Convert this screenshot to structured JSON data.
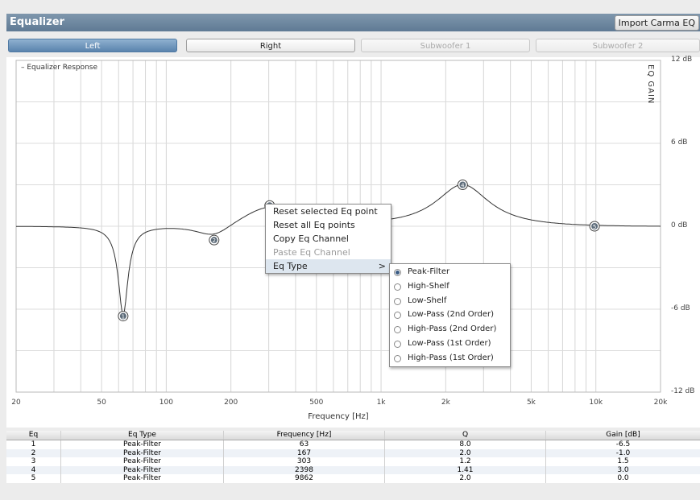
{
  "window": {
    "title": "Equalizer",
    "import_button": "Import Carma EQ"
  },
  "tabs": [
    {
      "label": "Left",
      "state": "active"
    },
    {
      "label": "Right",
      "state": "normal"
    },
    {
      "label": "Subwoofer 1",
      "state": "disabled"
    },
    {
      "label": "Subwoofer 2",
      "state": "disabled"
    }
  ],
  "chart_data": {
    "type": "line",
    "legend_label": "– Equalizer Response",
    "y_axis_label": "EQ GAIN",
    "xlabel": "Frequency [Hz]",
    "x_scale": "log",
    "xlim": [
      20,
      20000
    ],
    "ylim": [
      -12,
      12
    ],
    "x_ticks": [
      {
        "value": 20,
        "label": "20"
      },
      {
        "value": 50,
        "label": "50"
      },
      {
        "value": 100,
        "label": "100"
      },
      {
        "value": 200,
        "label": "200"
      },
      {
        "value": 500,
        "label": "500"
      },
      {
        "value": 1000,
        "label": "1k"
      },
      {
        "value": 2000,
        "label": "2k"
      },
      {
        "value": 5000,
        "label": "5k"
      },
      {
        "value": 10000,
        "label": "10k"
      },
      {
        "value": 20000,
        "label": "20k"
      }
    ],
    "y_ticks": [
      {
        "value": 12,
        "label": "12 dB"
      },
      {
        "value": 6,
        "label": "6 dB"
      },
      {
        "value": 0,
        "label": "0 dB"
      },
      {
        "value": -6,
        "label": "-6 dB"
      },
      {
        "value": -12,
        "label": "-12 dB"
      }
    ],
    "eq_points": [
      {
        "id": "1",
        "freq": 63,
        "gain": -6.5,
        "q": 8.0
      },
      {
        "id": "2",
        "freq": 167,
        "gain": -1.0,
        "q": 2.0
      },
      {
        "id": "3",
        "freq": 303,
        "gain": 1.5,
        "q": 1.2
      },
      {
        "id": "4",
        "freq": 2398,
        "gain": 3.0,
        "q": 1.41
      },
      {
        "id": "5",
        "freq": 9862,
        "gain": 0.0,
        "q": 2.0
      }
    ],
    "grid": true
  },
  "context_menu": {
    "items": [
      {
        "label": "Reset selected Eq point",
        "enabled": true
      },
      {
        "label": "Reset all Eq points",
        "enabled": true
      },
      {
        "label": "Copy Eq Channel",
        "enabled": true
      },
      {
        "label": "Paste Eq Channel",
        "enabled": false
      },
      {
        "label": "Eq Type",
        "enabled": true,
        "submenu": true,
        "arrow": ">"
      }
    ],
    "submenu": [
      {
        "label": "Peak-Filter",
        "selected": true
      },
      {
        "label": "High-Shelf",
        "selected": false
      },
      {
        "label": "Low-Shelf",
        "selected": false
      },
      {
        "label": "Low-Pass (2nd Order)",
        "selected": false
      },
      {
        "label": "High-Pass (2nd Order)",
        "selected": false
      },
      {
        "label": "Low-Pass (1st Order)",
        "selected": false
      },
      {
        "label": "High-Pass (1st Order)",
        "selected": false
      }
    ]
  },
  "table": {
    "columns": [
      "Eq",
      "Eq Type",
      "Frequency [Hz]",
      "Q",
      "Gain [dB]"
    ],
    "rows": [
      [
        "1",
        "Peak-Filter",
        "63",
        "8.0",
        "-6.5"
      ],
      [
        "2",
        "Peak-Filter",
        "167",
        "2.0",
        "-1.0"
      ],
      [
        "3",
        "Peak-Filter",
        "303",
        "1.2",
        "1.5"
      ],
      [
        "4",
        "Peak-Filter",
        "2398",
        "1.41",
        "3.0"
      ],
      [
        "5",
        "Peak-Filter",
        "9862",
        "2.0",
        "0.0"
      ]
    ]
  }
}
